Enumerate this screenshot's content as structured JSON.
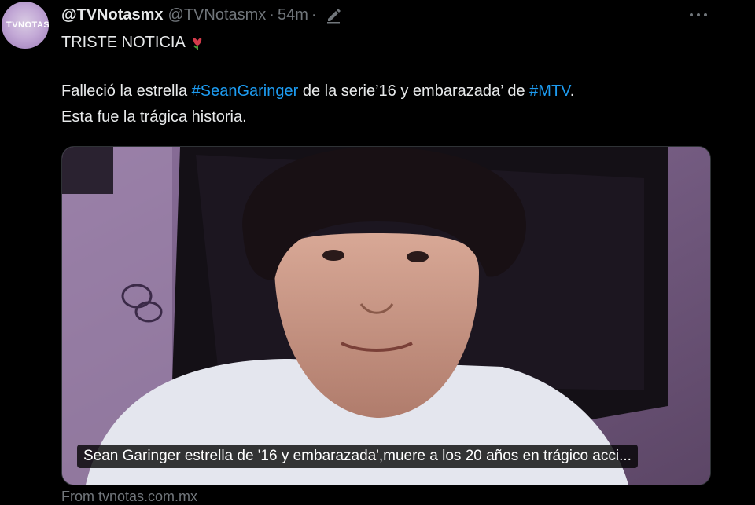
{
  "tweet": {
    "display_name": "@TVNotasmx",
    "handle": "@TVNotasmx",
    "separator": "·",
    "time": "54m",
    "separator2": "·",
    "avatar_logo": "TVNOTAS",
    "line1": "TRISTE NOTICIA",
    "line2_pre": "Falleció la estrella ",
    "hashtag1": "#SeanGaringer",
    "line2_mid": " de la serie’16 y embarazada’ de ",
    "hashtag2": "#MTV",
    "line2_post": ".",
    "line3": "Esta fue la trágica historia.",
    "emoji_icon": "wilted-rose-icon",
    "more_icon": "more-horizontal-icon",
    "edit_icon": "edit-pencil-icon"
  },
  "card": {
    "caption": "Sean Garinger estrella de '16 y embarazada',muere a los 20 años en trágico acci...",
    "source": "From tvnotas.com.mx"
  },
  "colors": {
    "background": "#000000",
    "text": "#e7e9ea",
    "muted": "#71767b",
    "link": "#1d9bf0"
  }
}
